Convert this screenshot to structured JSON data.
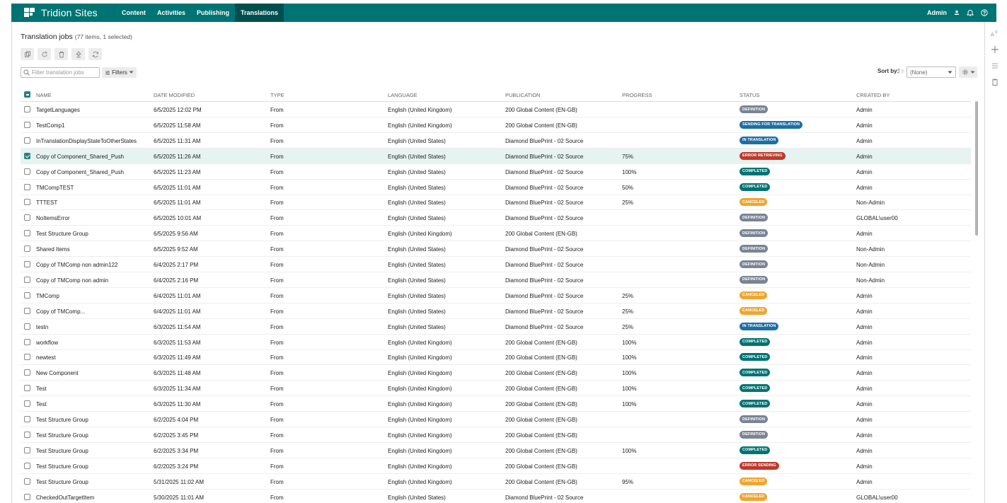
{
  "app": {
    "title": "Tridion Sites"
  },
  "nav": [
    {
      "label": "Content",
      "active": false
    },
    {
      "label": "Activities",
      "active": false
    },
    {
      "label": "Publishing",
      "active": false
    },
    {
      "label": "Translations",
      "active": true
    }
  ],
  "user": {
    "name": "Admin"
  },
  "page": {
    "title": "Translation jobs",
    "count": "(77 items, 1 selected)"
  },
  "filter": {
    "placeholder": "Filter translation jobs",
    "filters_label": "Filters"
  },
  "sort": {
    "label": "Sort by:",
    "value": "(None)"
  },
  "columns": {
    "name": "NAME",
    "date": "DATE MODIFIED",
    "type": "TYPE",
    "language": "LANGUAGE",
    "publication": "PUBLICATION",
    "progress": "PROGRESS",
    "status": "STATUS",
    "created_by": "CREATED BY"
  },
  "status_colors": {
    "DEFINITION": "#7a8494",
    "SENDING FOR TRANSLATION": "#1d6fa5",
    "IN TRANSLATION": "#1d6fa5",
    "ERROR RETRIEVING": "#c0392b",
    "ERROR SENDING": "#c0392b",
    "COMPLETED": "#007373",
    "CANCELED": "#f0a530"
  },
  "rows": [
    {
      "name": "TargetLanguages",
      "date": "6/5/2025 12:02 PM",
      "type": "From",
      "language": "English (United Kingdom)",
      "publication": "200 Global Content (EN-GB)",
      "progress": "",
      "status": "DEFINITION",
      "created_by": "Admin",
      "selected": false
    },
    {
      "name": "TestComp1",
      "date": "6/5/2025 11:58 AM",
      "type": "From",
      "language": "English (United Kingdom)",
      "publication": "200 Global Content (EN-GB)",
      "progress": "",
      "status": "SENDING FOR TRANSLATION",
      "created_by": "Admin",
      "selected": false
    },
    {
      "name": "InTranslationDisplayStateToOtherStates",
      "date": "6/5/2025 11:31 AM",
      "type": "From",
      "language": "English (United States)",
      "publication": "Diamond BluePrint - 02 Source",
      "progress": "",
      "status": "IN TRANSLATION",
      "created_by": "Admin",
      "selected": false
    },
    {
      "name": "Copy of Component_Shared_Push",
      "date": "6/5/2025 11:26 AM",
      "type": "From",
      "language": "English (United States)",
      "publication": "Diamond BluePrint - 02 Source",
      "progress": "75%",
      "status": "ERROR RETRIEVING",
      "created_by": "Admin",
      "selected": true
    },
    {
      "name": "Copy of Component_Shared_Push",
      "date": "6/5/2025 11:23 AM",
      "type": "From",
      "language": "English (United States)",
      "publication": "Diamond BluePrint - 02 Source",
      "progress": "100%",
      "status": "COMPLETED",
      "created_by": "Admin",
      "selected": false
    },
    {
      "name": "TMCompTEST",
      "date": "6/5/2025 11:01 AM",
      "type": "From",
      "language": "English (United States)",
      "publication": "Diamond BluePrint - 02 Source",
      "progress": "50%",
      "status": "COMPLETED",
      "created_by": "Admin",
      "selected": false
    },
    {
      "name": "TTTEST",
      "date": "6/5/2025 11:01 AM",
      "type": "From",
      "language": "English (United States)",
      "publication": "Diamond BluePrint - 02 Source",
      "progress": "25%",
      "status": "CANCELED",
      "created_by": "Non-Admin",
      "selected": false
    },
    {
      "name": "NoItemsError",
      "date": "6/5/2025 10:01 AM",
      "type": "From",
      "language": "English (United States)",
      "publication": "Diamond BluePrint - 02 Source",
      "progress": "",
      "status": "DEFINITION",
      "created_by": "GLOBAL\\user00",
      "selected": false
    },
    {
      "name": "Test Structure Group",
      "date": "6/5/2025 9:56 AM",
      "type": "From",
      "language": "English (United Kingdom)",
      "publication": "200 Global Content (EN-GB)",
      "progress": "",
      "status": "DEFINITION",
      "created_by": "Admin",
      "selected": false
    },
    {
      "name": "Shared Items",
      "date": "6/5/2025 9:52 AM",
      "type": "From",
      "language": "English (United States)",
      "publication": "Diamond BluePrint - 02 Source",
      "progress": "",
      "status": "DEFINITION",
      "created_by": "Non-Admin",
      "selected": false
    },
    {
      "name": "Copy of TMComp non admin122",
      "date": "6/4/2025 2:17 PM",
      "type": "From",
      "language": "English (United States)",
      "publication": "Diamond BluePrint - 02 Source",
      "progress": "",
      "status": "DEFINITION",
      "created_by": "Non-Admin",
      "selected": false
    },
    {
      "name": "Copy of TMComp non admin",
      "date": "6/4/2025 2:16 PM",
      "type": "From",
      "language": "English (United States)",
      "publication": "Diamond BluePrint - 02 Source",
      "progress": "",
      "status": "DEFINITION",
      "created_by": "Non-Admin",
      "selected": false
    },
    {
      "name": "TMComp",
      "date": "6/4/2025 11:01 AM",
      "type": "From",
      "language": "English (United States)",
      "publication": "Diamond BluePrint - 02 Source",
      "progress": "25%",
      "status": "CANCELED",
      "created_by": "Admin",
      "selected": false
    },
    {
      "name": "Copy of TMComp...",
      "date": "6/4/2025 11:01 AM",
      "type": "From",
      "language": "English (United States)",
      "publication": "Diamond BluePrint - 02 Source",
      "progress": "25%",
      "status": "CANCELED",
      "created_by": "Admin",
      "selected": false
    },
    {
      "name": "testn",
      "date": "6/3/2025 11:54 AM",
      "type": "From",
      "language": "English (United States)",
      "publication": "Diamond BluePrint - 02 Source",
      "progress": "25%",
      "status": "IN TRANSLATION",
      "created_by": "Admin",
      "selected": false
    },
    {
      "name": "workflow",
      "date": "6/3/2025 11:53 AM",
      "type": "From",
      "language": "English (United Kingdom)",
      "publication": "200 Global Content (EN-GB)",
      "progress": "100%",
      "status": "COMPLETED",
      "created_by": "Admin",
      "selected": false
    },
    {
      "name": "newtest",
      "date": "6/3/2025 11:49 AM",
      "type": "From",
      "language": "English (United Kingdom)",
      "publication": "200 Global Content (EN-GB)",
      "progress": "100%",
      "status": "COMPLETED",
      "created_by": "Admin",
      "selected": false
    },
    {
      "name": "New Component",
      "date": "6/3/2025 11:48 AM",
      "type": "From",
      "language": "English (United Kingdom)",
      "publication": "200 Global Content (EN-GB)",
      "progress": "100%",
      "status": "COMPLETED",
      "created_by": "Admin",
      "selected": false
    },
    {
      "name": "Test",
      "date": "6/3/2025 11:34 AM",
      "type": "From",
      "language": "English (United Kingdom)",
      "publication": "200 Global Content (EN-GB)",
      "progress": "100%",
      "status": "COMPLETED",
      "created_by": "Admin",
      "selected": false
    },
    {
      "name": "Test",
      "date": "6/3/2025 11:30 AM",
      "type": "From",
      "language": "English (United Kingdom)",
      "publication": "200 Global Content (EN-GB)",
      "progress": "100%",
      "status": "COMPLETED",
      "created_by": "Admin",
      "selected": false
    },
    {
      "name": "Test Structure Group",
      "date": "6/2/2025 4:04 PM",
      "type": "From",
      "language": "English (United Kingdom)",
      "publication": "200 Global Content (EN-GB)",
      "progress": "",
      "status": "DEFINITION",
      "created_by": "Admin",
      "selected": false
    },
    {
      "name": "Test Structure Group",
      "date": "6/2/2025 3:45 PM",
      "type": "From",
      "language": "English (United Kingdom)",
      "publication": "200 Global Content (EN-GB)",
      "progress": "",
      "status": "DEFINITION",
      "created_by": "Admin",
      "selected": false
    },
    {
      "name": "Test Structure Group",
      "date": "6/2/2025 3:34 PM",
      "type": "From",
      "language": "English (United Kingdom)",
      "publication": "200 Global Content (EN-GB)",
      "progress": "100%",
      "status": "COMPLETED",
      "created_by": "Admin",
      "selected": false
    },
    {
      "name": "Test Structure Group",
      "date": "6/2/2025 3:24 PM",
      "type": "From",
      "language": "English (United Kingdom)",
      "publication": "200 Global Content (EN-GB)",
      "progress": "",
      "status": "ERROR SENDING",
      "created_by": "Admin",
      "selected": false
    },
    {
      "name": "Test Structure Group",
      "date": "5/31/2025 11:02 AM",
      "type": "From",
      "language": "English (United Kingdom)",
      "publication": "200 Global Content (EN-GB)",
      "progress": "95%",
      "status": "CANCELED",
      "created_by": "Admin",
      "selected": false
    },
    {
      "name": "CheckedOutTargetItem",
      "date": "5/30/2025 11:01 AM",
      "type": "From",
      "language": "English (United States)",
      "publication": "Diamond BluePrint - 02 Source",
      "progress": "",
      "status": "CANCELED",
      "created_by": "GLOBAL\\user00",
      "selected": false
    }
  ]
}
